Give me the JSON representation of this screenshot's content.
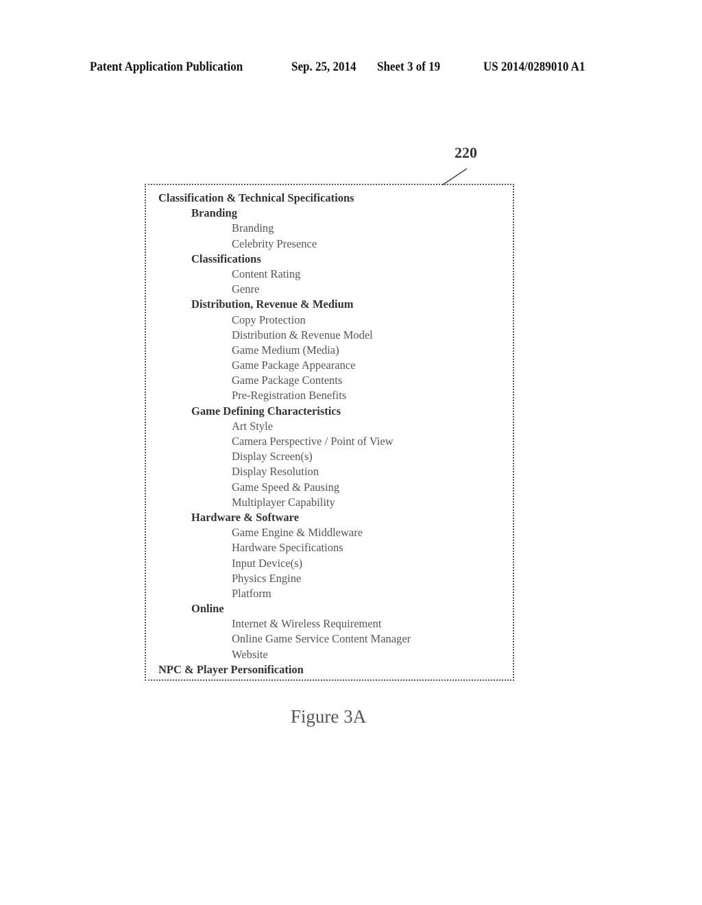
{
  "header": {
    "publication": "Patent Application Publication",
    "date": "Sep. 25, 2014",
    "sheet": "Sheet 3 of 19",
    "number": "US 2014/0289010 A1"
  },
  "figure": {
    "reference_numeral": "220",
    "caption": "Figure 3A",
    "items": [
      {
        "level": 0,
        "text": "Classification & Technical Specifications"
      },
      {
        "level": 1,
        "text": "Branding"
      },
      {
        "level": 2,
        "text": "Branding"
      },
      {
        "level": 2,
        "text": "Celebrity Presence"
      },
      {
        "level": 1,
        "text": "Classifications"
      },
      {
        "level": 2,
        "text": "Content Rating"
      },
      {
        "level": 2,
        "text": "Genre"
      },
      {
        "level": 1,
        "text": "Distribution, Revenue & Medium"
      },
      {
        "level": 2,
        "text": "Copy Protection"
      },
      {
        "level": 2,
        "text": "Distribution & Revenue Model"
      },
      {
        "level": 2,
        "text": "Game Medium (Media)"
      },
      {
        "level": 2,
        "text": "Game Package Appearance"
      },
      {
        "level": 2,
        "text": "Game Package Contents"
      },
      {
        "level": 2,
        "text": "Pre-Registration Benefits"
      },
      {
        "level": 1,
        "text": "Game Defining Characteristics"
      },
      {
        "level": 2,
        "text": "Art Style"
      },
      {
        "level": 2,
        "text": "Camera Perspective / Point of View"
      },
      {
        "level": 2,
        "text": "Display Screen(s)"
      },
      {
        "level": 2,
        "text": "Display Resolution"
      },
      {
        "level": 2,
        "text": "Game Speed & Pausing"
      },
      {
        "level": 2,
        "text": "Multiplayer Capability"
      },
      {
        "level": 1,
        "text": "Hardware & Software"
      },
      {
        "level": 2,
        "text": "Game Engine & Middleware"
      },
      {
        "level": 2,
        "text": "Hardware Specifications"
      },
      {
        "level": 2,
        "text": "Input Device(s)"
      },
      {
        "level": 2,
        "text": "Physics Engine"
      },
      {
        "level": 2,
        "text": "Platform"
      },
      {
        "level": 1,
        "text": "Online"
      },
      {
        "level": 2,
        "text": "Internet & Wireless Requirement"
      },
      {
        "level": 2,
        "text": "Online Game Service Content Manager"
      },
      {
        "level": 2,
        "text": "Website"
      },
      {
        "level": 0,
        "text": "NPC & Player Personification"
      }
    ]
  }
}
